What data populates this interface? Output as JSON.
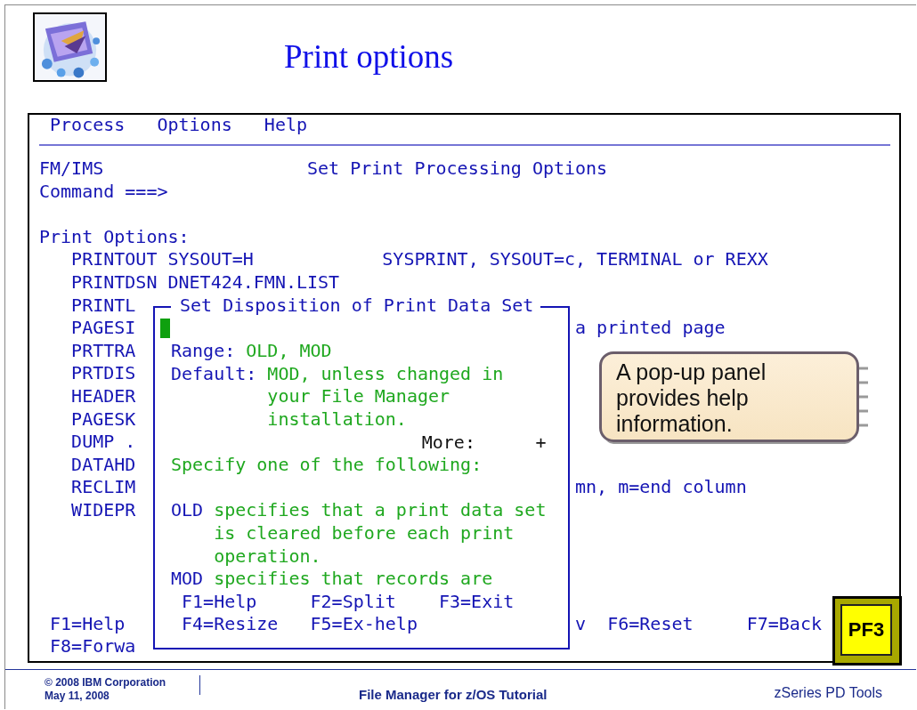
{
  "slide": {
    "title": "Print options"
  },
  "terminal": {
    "menu": [
      {
        "label": "Process"
      },
      {
        "label": "Options"
      },
      {
        "label": "Help"
      }
    ],
    "product": "FM/IMS",
    "panel_title": "Set Print Processing Options",
    "command_label": "Command ===>",
    "section": "Print Options:",
    "options": [
      {
        "name": "PRINTOUT",
        "value": "SYSOUT=H",
        "note": "SYSPRINT, SYSOUT=c, TERMINAL or REXX"
      },
      {
        "name": "PRINTDSN",
        "value": "DNET424.FMN.LIST"
      },
      {
        "name": "PRINTL"
      },
      {
        "name": "PAGESI",
        "note": "a printed page"
      },
      {
        "name": "PRTTRA"
      },
      {
        "name": "PRTDIS"
      },
      {
        "name": "HEADER"
      },
      {
        "name": "PAGESK"
      },
      {
        "name": "DUMP ."
      },
      {
        "name": "DATAHD"
      },
      {
        "name": "RECLIM",
        "note": "mn, m=end column"
      },
      {
        "name": "WIDEPR"
      }
    ],
    "function_keys": [
      [
        "F1=Help",
        "v",
        "F6=Reset",
        "F7=Back"
      ],
      [
        "F8=Forwa"
      ]
    ]
  },
  "popup": {
    "title": "Set Disposition of Print Data Set",
    "range_label": "Range:",
    "range_value": "OLD, MOD",
    "default_label": "Default:",
    "default_lines": [
      "MOD, unless changed in",
      "your File Manager",
      "installation."
    ],
    "more_label": "More:",
    "more_sign": "+",
    "prompt": "Specify one of the following:",
    "choices": [
      {
        "code": "OLD",
        "lines": [
          "specifies that a print data set",
          "is cleared before each print",
          "operation."
        ]
      },
      {
        "code": "MOD",
        "lines": [
          "specifies that records are"
        ]
      }
    ],
    "function_keys": [
      [
        "F1=Help",
        "F2=Split",
        "F3=Exit"
      ],
      [
        "F4=Resize",
        "F5=Ex-help"
      ]
    ]
  },
  "callout": {
    "text": "A pop-up panel provides help information."
  },
  "key": {
    "label": "PF3"
  },
  "footer": {
    "copyright": "© 2008 IBM Corporation",
    "date": "May 11, 2008",
    "center": "File Manager for z/OS Tutorial",
    "right": "zSeries PD Tools"
  }
}
